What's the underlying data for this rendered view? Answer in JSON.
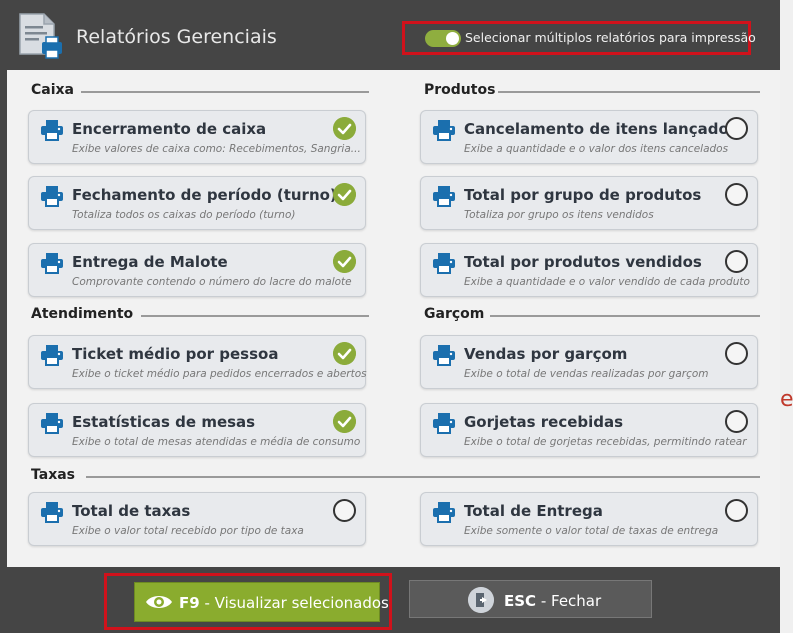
{
  "header": {
    "title": "Relatórios Gerenciais",
    "toggle_label": "Selecionar múltiplos relatórios para impressão",
    "toggle_on": true
  },
  "sections": {
    "caixa": "Caixa",
    "produtos": "Produtos",
    "atendimento": "Atendimento",
    "garcom": "Garçom",
    "taxas": "Taxas"
  },
  "reports": [
    {
      "title": "Encerramento de caixa",
      "desc": "Exibe valores de caixa como: Recebimentos, Sangria...",
      "selected": true
    },
    {
      "title": "Fechamento de período (turno)",
      "desc": "Totaliza todos os caixas do período (turno)",
      "selected": true
    },
    {
      "title": "Entrega de Malote",
      "desc": "Comprovante contendo o número do lacre do malote",
      "selected": true
    },
    {
      "title": "Cancelamento de itens lançados",
      "desc": "Exibe a quantidade e o valor dos itens cancelados",
      "selected": false
    },
    {
      "title": "Total por grupo de produtos",
      "desc": "Totaliza por grupo os itens vendidos",
      "selected": false
    },
    {
      "title": "Total por produtos vendidos",
      "desc": "Exibe a quantidade e o valor vendido de cada produto",
      "selected": false
    },
    {
      "title": "Ticket médio por pessoa",
      "desc": "Exibe o ticket médio para pedidos encerrados e abertos",
      "selected": true
    },
    {
      "title": "Estatísticas de mesas",
      "desc": "Exibe o total de mesas atendidas e média de consumo",
      "selected": true
    },
    {
      "title": "Vendas por garçom",
      "desc": "Exibe o total de vendas realizadas por garçom",
      "selected": false
    },
    {
      "title": "Gorjetas recebidas",
      "desc": "Exibe o total de gorjetas recebidas, permitindo ratear",
      "selected": false
    },
    {
      "title": "Total de taxas",
      "desc": "Exibe o valor total recebido por tipo de taxa",
      "selected": false
    },
    {
      "title": "Total de Entrega",
      "desc": "Exibe somente o valor total de taxas de entrega",
      "selected": false
    }
  ],
  "footer": {
    "view_key": "F9",
    "view_label": " - Visualizar selecionados",
    "close_key": "ESC",
    "close_label": " - Fechar"
  },
  "colors": {
    "accent_green": "#8aac2e",
    "check_green": "#8bab3a",
    "printer_blue": "#1b6fae",
    "highlight_red": "#d0121b",
    "header_bg": "#454545"
  },
  "icons": {
    "app": "report-printer-icon",
    "printer": "printer-icon",
    "check": "check-circle-icon",
    "view": "eye-icon",
    "close": "exit-door-icon"
  }
}
